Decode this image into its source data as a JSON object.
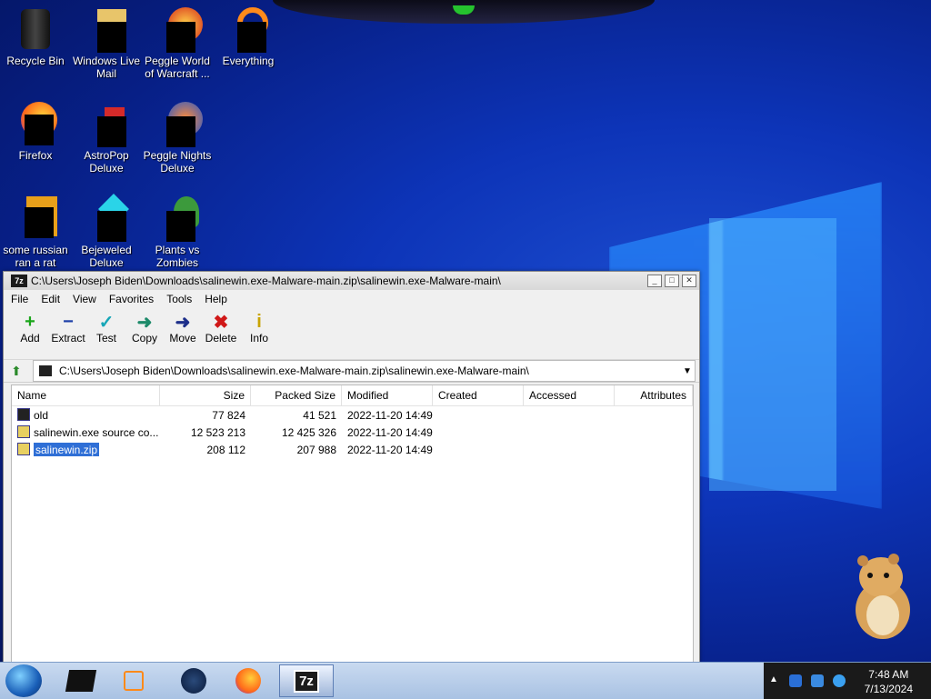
{
  "desktop": {
    "icons": [
      {
        "label": "Recycle Bin",
        "icon": "recycle-bin-icon"
      },
      {
        "label": "Windows Live Mail",
        "icon": "mail-icon"
      },
      {
        "label": "Peggle World of Warcraft ...",
        "icon": "peggle-icon"
      },
      {
        "label": "Everything",
        "icon": "everything-icon"
      },
      {
        "label": "Firefox",
        "icon": "firefox-icon"
      },
      {
        "label": "AstroPop Deluxe",
        "icon": "astropop-icon"
      },
      {
        "label": "Peggle Nights Deluxe",
        "icon": "peggle-nights-icon"
      },
      {
        "label": "some russian ran a rat",
        "icon": "file-icon"
      },
      {
        "label": "Bejeweled Deluxe",
        "icon": "bejeweled-icon"
      },
      {
        "label": "Plants vs Zombies",
        "icon": "pvz-icon"
      }
    ]
  },
  "window": {
    "title": "C:\\Users\\Joseph Biden\\Downloads\\salinewin.exe-Malware-main.zip\\salinewin.exe-Malware-main\\",
    "app_icon_text": "7z",
    "menu": [
      "File",
      "Edit",
      "View",
      "Favorites",
      "Tools",
      "Help"
    ],
    "toolbar": [
      {
        "label": "Add",
        "icon": "add-icon",
        "glyph": "+",
        "color": "#1aa51a"
      },
      {
        "label": "Extract",
        "icon": "extract-icon",
        "glyph": "−",
        "color": "#1d3fa8"
      },
      {
        "label": "Test",
        "icon": "test-icon",
        "glyph": "✓",
        "color": "#18a7b8"
      },
      {
        "label": "Copy",
        "icon": "copy-icon",
        "glyph": "➜",
        "color": "#1d8a6a"
      },
      {
        "label": "Move",
        "icon": "move-icon",
        "glyph": "➜",
        "color": "#1d2f8a"
      },
      {
        "label": "Delete",
        "icon": "delete-icon",
        "glyph": "✖",
        "color": "#d01818"
      },
      {
        "label": "Info",
        "icon": "info-icon",
        "glyph": "i",
        "color": "#c8a400"
      }
    ],
    "address": "C:\\Users\\Joseph Biden\\Downloads\\salinewin.exe-Malware-main.zip\\salinewin.exe-Malware-main\\",
    "columns": [
      "Name",
      "Size",
      "Packed Size",
      "Modified",
      "Created",
      "Accessed",
      "Attributes"
    ],
    "rows": [
      {
        "name": "old",
        "size": "77 824",
        "packed": "41 521",
        "modified": "2022-11-20 14:49",
        "created": "",
        "accessed": "",
        "attributes": "",
        "icon": "folder-icon",
        "selected": false
      },
      {
        "name": "salinewin.exe source co...",
        "size": "12 523 213",
        "packed": "12 425 326",
        "modified": "2022-11-20 14:49",
        "created": "",
        "accessed": "",
        "attributes": "",
        "icon": "zip-icon",
        "selected": false
      },
      {
        "name": "salinewin.zip",
        "size": "208 112",
        "packed": "207 988",
        "modified": "2022-11-20 14:49",
        "created": "",
        "accessed": "",
        "attributes": "",
        "icon": "zip-icon",
        "selected": true
      }
    ]
  },
  "taskbar": {
    "active_label": "7z",
    "time": "7:48 AM",
    "date": "7/13/2024"
  }
}
